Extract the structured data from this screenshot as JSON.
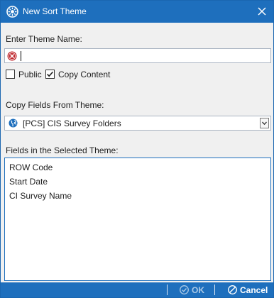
{
  "window": {
    "title": "New Sort Theme",
    "app_icon": "theme-gear-icon",
    "close_icon": "close-icon"
  },
  "theme_name": {
    "label": "Enter Theme Name:",
    "value": "",
    "validation_icon": "error-icon"
  },
  "options": {
    "public": {
      "label": "Public",
      "checked": false
    },
    "copy_content": {
      "label": "Copy Content",
      "checked": true
    }
  },
  "copy_fields": {
    "label": "Copy Fields From Theme:",
    "selected": "[PCS] CIS Survey Folders",
    "icon": "globe-icon"
  },
  "fields": {
    "label": "Fields in the Selected Theme:",
    "items": [
      "ROW Code",
      "Start Date",
      "CI Survey Name"
    ]
  },
  "footer": {
    "ok_label": "OK",
    "cancel_label": "Cancel",
    "ok_enabled": false
  },
  "colors": {
    "accent": "#1e6fbd",
    "error": "#c0282d"
  }
}
